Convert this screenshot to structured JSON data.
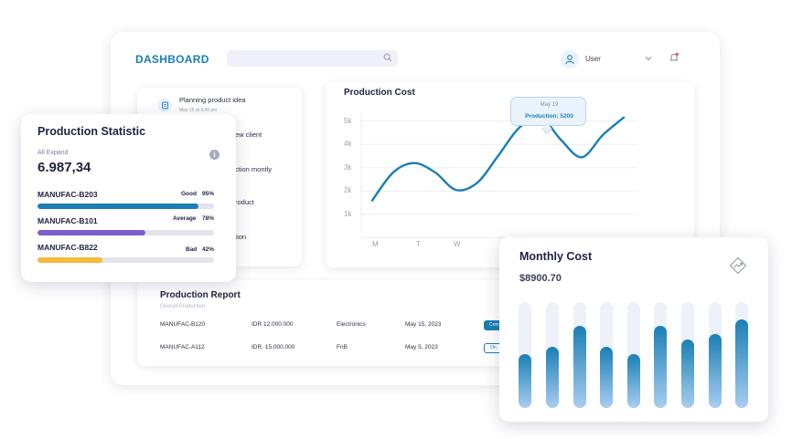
{
  "header": {
    "title": "DASHBOARD",
    "user_name": "User",
    "icons": [
      "search-icon",
      "user-icon",
      "chevron-down-icon",
      "bell-icon"
    ]
  },
  "activity": {
    "items": [
      {
        "label": "Planning product idea",
        "time": "May 15 at 9.00 pm"
      },
      {
        "label": "ew client"
      },
      {
        "label": "ction montly"
      },
      {
        "label": "roduct"
      },
      {
        "label": "tion"
      }
    ]
  },
  "production_cost": {
    "title": "Production Cost",
    "tooltip": {
      "date": "May 19",
      "value": "Production: 5200"
    }
  },
  "chart_data": [
    {
      "type": "line",
      "title": "Production Cost",
      "x_ticks": [
        "M",
        "T",
        "W"
      ],
      "y_ticks": [
        "1k",
        "2k",
        "3k",
        "4k",
        "5k"
      ],
      "ylim": [
        0,
        5000
      ],
      "grid": true,
      "series": [
        {
          "values": [
            1600,
            2800,
            3200,
            2800,
            2050,
            2350,
            3500,
            4700,
            5200,
            4200,
            3450,
            4400,
            5150
          ]
        }
      ]
    },
    {
      "type": "bar",
      "title": "Monthly Cost",
      "values": [
        51,
        58,
        78,
        58,
        51,
        78,
        65,
        70,
        84
      ],
      "ylim": [
        0,
        100
      ],
      "grid": false
    }
  ],
  "report": {
    "title": "Production Report",
    "subtitle": "Overall Production",
    "rows": [
      {
        "id": "MANUFAC-B120",
        "amount": "IDR 12.000.000",
        "category": "Electronics",
        "date": "May 15, 2023",
        "status": "Com"
      },
      {
        "id": "MANUFAC-A112",
        "amount": "IDR. 15.000.000",
        "category": "FnB",
        "date": "May 5, 2023",
        "status": "On"
      }
    ]
  },
  "statistic": {
    "title": "Production Statistic",
    "subtitle": "All Expand",
    "value": "6.987,34",
    "rows": [
      {
        "name": "MANUFAC-B203",
        "status": "Good",
        "percent": "95%",
        "fraction": 0.91,
        "color": "#1a7fb5"
      },
      {
        "name": "MANUFAC-B101",
        "status": "Average",
        "percent": "78%",
        "fraction": 0.61,
        "color": "#7a5fd0"
      },
      {
        "name": "MANUFAC-B822",
        "status": "Bad",
        "percent": "42%",
        "fraction": 0.37,
        "color": "#f5b93c"
      }
    ]
  },
  "monthly": {
    "title": "Monthly Cost",
    "value": "$8900.70"
  },
  "colors": {
    "accent": "#1a7fb5",
    "purple": "#7a5fd0",
    "amber": "#f5b93c"
  }
}
